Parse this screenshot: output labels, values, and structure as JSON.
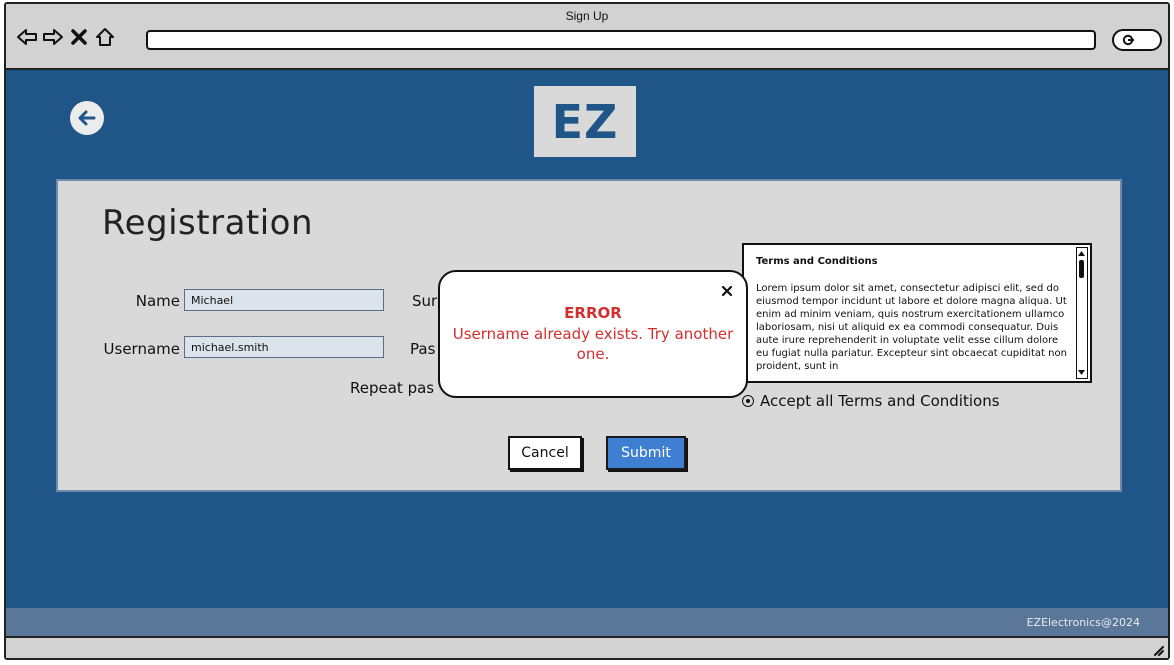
{
  "window": {
    "title": "Sign Up"
  },
  "browser": {
    "icons": [
      "back-arrow-icon",
      "forward-arrow-icon",
      "close-x-icon",
      "home-icon",
      "search-icon"
    ]
  },
  "header": {
    "logo_text": "EZ",
    "back_icon": "arrow-left-icon"
  },
  "form": {
    "title": "Registration",
    "name_label": "Name",
    "name_value": "Michael",
    "surname_label_visible": "Sur",
    "username_label": "Username",
    "username_value": "michael.smith",
    "password_label_visible": "Pas",
    "repeat_password_label_visible": "Repeat pas",
    "terms": {
      "title": "Terms and Conditions",
      "body": "Lorem ipsum dolor sit amet, consectetur adipisci elit, sed do eiusmod tempor incidunt ut labore et dolore magna aliqua. Ut enim ad minim veniam, quis nostrum exercitationem ullamco laboriosam, nisi ut aliquid ex ea commodi consequatur. Duis aute irure reprehenderit in voluptate velit esse cillum dolore eu fugiat nulla pariatur. Excepteur sint obcaecat cupiditat non proident, sunt in"
    },
    "accept_label": "Accept all Terms and Conditions",
    "cancel_label": "Cancel",
    "submit_label": "Submit"
  },
  "error_dialog": {
    "close_glyph": "×",
    "title": "ERROR",
    "message": "Username already exists. Try another one."
  },
  "footer": {
    "text": "EZElectronics@2024"
  },
  "colors": {
    "page_background": "#1f5587",
    "panel_background": "#d9d9d9",
    "footer_background": "#5a7799",
    "submit_button": "#3f7fd1",
    "error_text": "#d32f2f"
  }
}
